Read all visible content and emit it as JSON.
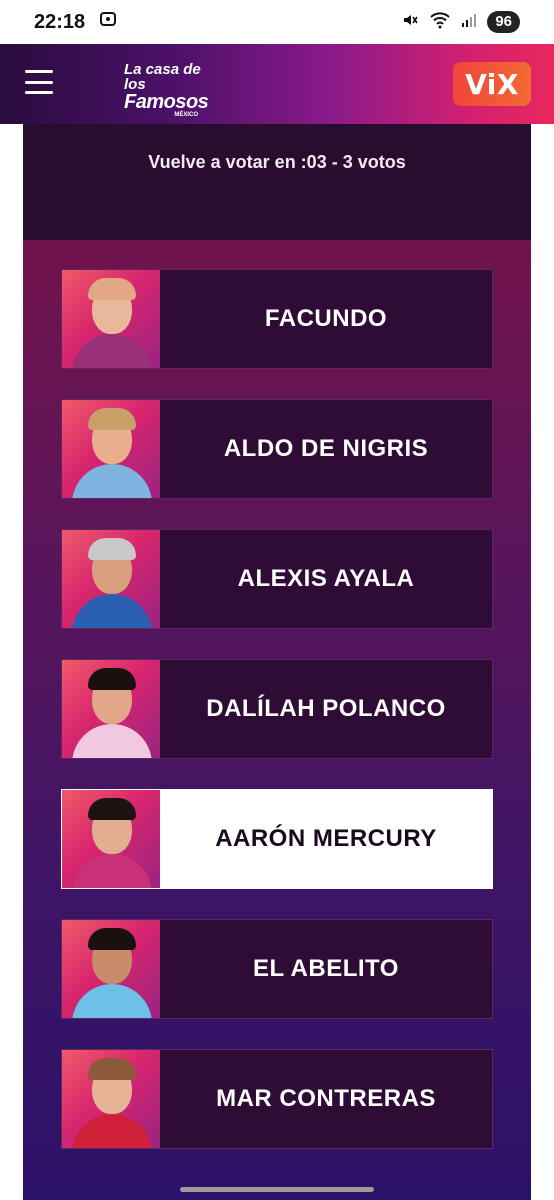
{
  "status_bar": {
    "time": "22:18",
    "battery": "96",
    "icons": [
      "screenshot-icon",
      "mute-icon",
      "wifi-icon",
      "signal-icon"
    ]
  },
  "header": {
    "logo_line1": "La casa de los",
    "logo_line2": "Famosos",
    "logo_line3": "MÉXICO",
    "brand": "ViX",
    "accent": "#e8275d"
  },
  "vote_panel": {
    "message": "Vuelve a votar en :03 - 3 votos"
  },
  "contestants": [
    {
      "name": "FACUNDO",
      "selected": false,
      "skin": "#e9b89a",
      "hair": "#e0a887",
      "outfit": "#9a2f7a"
    },
    {
      "name": "ALDO DE NIGRIS",
      "selected": false,
      "skin": "#e8b08f",
      "hair": "#c9a067",
      "outfit": "#7fb3e0"
    },
    {
      "name": "ALEXIS AYALA",
      "selected": false,
      "skin": "#d99f7f",
      "hair": "#c8c8c8",
      "outfit": "#2b5fb0"
    },
    {
      "name": "DALÍLAH POLANCO",
      "selected": false,
      "skin": "#e0a888",
      "hair": "#1a1010",
      "outfit": "#f2c8e0"
    },
    {
      "name": "AARÓN MERCURY",
      "selected": true,
      "skin": "#e3ad8f",
      "hair": "#1c1212",
      "outfit": "#c93077"
    },
    {
      "name": "EL ABELITO",
      "selected": false,
      "skin": "#c98c6a",
      "hair": "#1a1010",
      "outfit": "#6fc0e8"
    },
    {
      "name": "MAR CONTRERAS",
      "selected": false,
      "skin": "#e7b394",
      "hair": "#8a5a3a",
      "outfit": "#d1203a"
    }
  ]
}
